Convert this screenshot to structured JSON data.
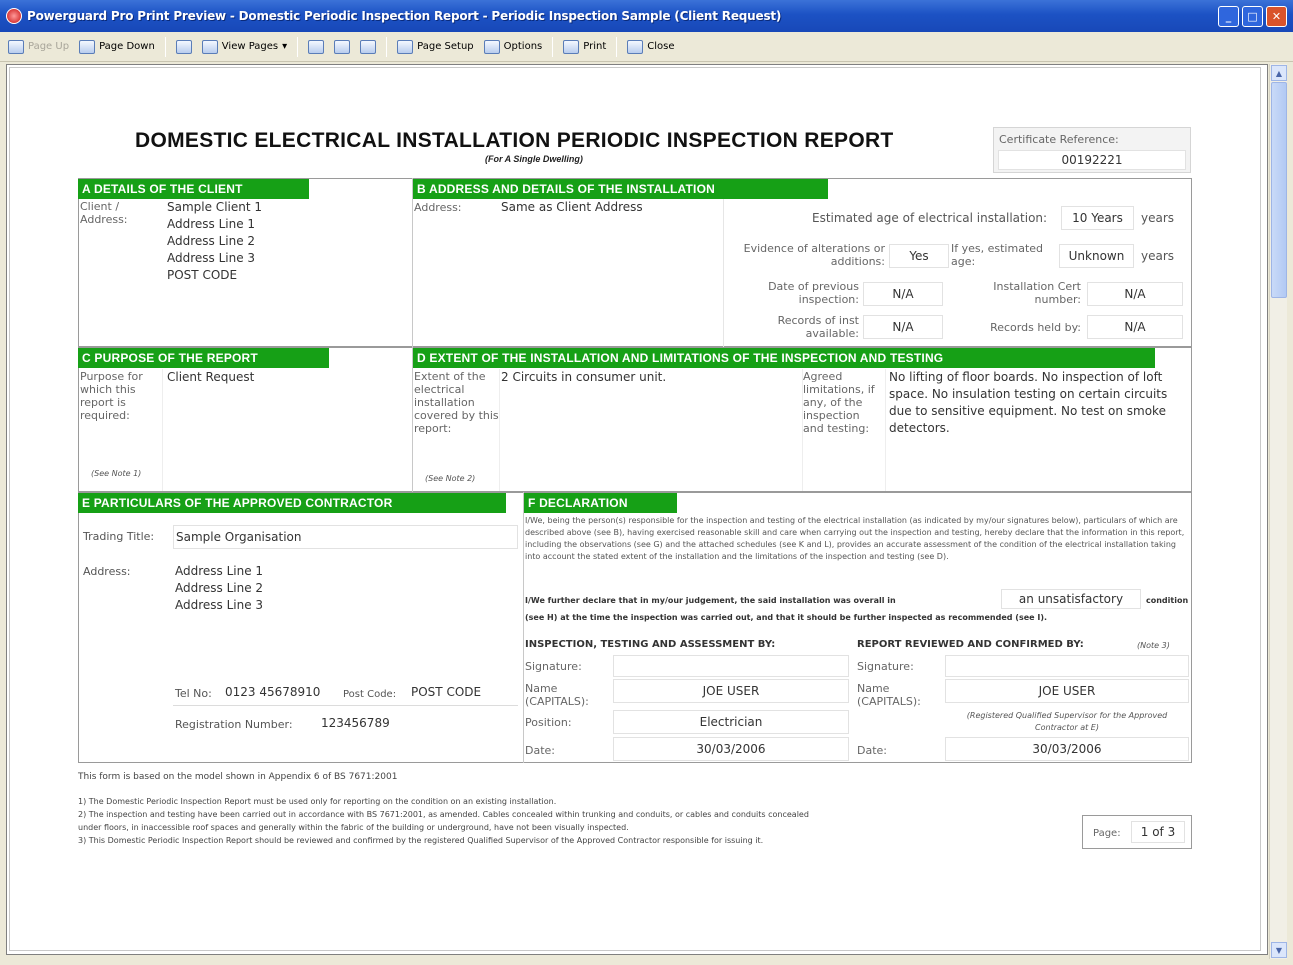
{
  "window": {
    "title": "Powerguard Pro Print Preview - Domestic Periodic Inspection Report - Periodic Inspection Sample (Client Request)"
  },
  "toolbar": {
    "page_up": "Page Up",
    "page_down": "Page Down",
    "view_pages": "View Pages",
    "page_setup": "Page Setup",
    "options": "Options",
    "print": "Print",
    "close": "Close"
  },
  "report": {
    "title": "DOMESTIC ELECTRICAL INSTALLATION PERIODIC INSPECTION REPORT",
    "subtitle": "(For A Single Dwelling)",
    "cert_ref_label": "Certificate Reference:",
    "cert_ref": "00192221",
    "sectionA": {
      "title": "A  DETAILS OF THE CLIENT",
      "client_label": "Client /",
      "address_label": "Address:",
      "lines": [
        "Sample Client 1",
        "Address Line 1",
        "Address Line 2",
        "Address Line 3",
        "POST CODE"
      ]
    },
    "sectionB": {
      "title": "B  ADDRESS AND DETAILS OF THE INSTALLATION",
      "address_label": "Address:",
      "address": "Same as Client Address",
      "est_age_label": "Estimated age of electrical installation:",
      "est_age": "10 Years",
      "years1": "years",
      "alterations_label": "Evidence of alterations or additions:",
      "alterations": "Yes",
      "alt_age_label": "If yes, estimated age:",
      "alt_age": "Unknown",
      "years2": "years",
      "prev_label": "Date of previous inspection:",
      "prev": "N/A",
      "cert_no_label": "Installation Cert number:",
      "cert_no": "N/A",
      "records_label": "Records of inst available:",
      "records": "N/A",
      "held_label": "Records held by:",
      "held": "N/A"
    },
    "sectionC": {
      "title": "C  PURPOSE OF THE REPORT",
      "label": "Purpose for which this report is required:",
      "value": "Client Request",
      "note": "(See Note 1)"
    },
    "sectionD": {
      "title": "D  EXTENT OF THE INSTALLATION AND LIMITATIONS OF THE INSPECTION AND TESTING",
      "extent_label": "Extent of the electrical installation covered by this report:",
      "extent": "2 Circuits in consumer unit.",
      "note": "(See Note 2)",
      "limits_label": "Agreed limitations, if any, of the inspection and testing:",
      "limits": "No lifting of floor boards. No inspection of loft space. No insulation testing on certain circuits due to sensitive equipment. No test on smoke detectors."
    },
    "sectionE": {
      "title": "E  PARTICULARS OF THE APPROVED CONTRACTOR",
      "trading_label": "Trading Title:",
      "trading": "Sample Organisation",
      "address_label": "Address:",
      "lines": [
        "Address Line 1",
        "Address Line 2",
        "Address Line 3"
      ],
      "tel_label": "Tel No:",
      "tel": "0123 45678910",
      "postcode_label": "Post Code:",
      "postcode": "POST CODE",
      "reg_label": "Registration Number:",
      "reg": "123456789"
    },
    "sectionF": {
      "title": "F  DECLARATION",
      "text1": "I/We, being the person(s) responsible for the inspection and testing of the electrical installation (as indicated by my/our signatures below), particulars of which are described above (see B), having exercised reasonable skill and care when carrying out the inspection and testing, hereby declare that the information in this report, including the observations (see G) and the attached schedules (see K and L), provides an accurate assessment of the condition of the electrical installation taking into account the stated extent of the installation and the limitations of the inspection and testing (see D).",
      "text2a": "I/We further declare that in my/our judgement, the said installation was overall in",
      "condition": "an unsatisfactory",
      "text2b": "condition",
      "text3": "(see H) at the time the inspection was carried out, and that it should be further inspected as recommended (see I).",
      "insp_title": "INSPECTION, TESTING AND ASSESSMENT BY:",
      "rev_title": "REPORT REVIEWED AND CONFIRMED BY:",
      "rev_note": "(Note 3)",
      "sig_label": "Signature:",
      "name_label": "Name (CAPITALS):",
      "pos_label": "Position:",
      "date_label": "Date:",
      "insp_name": "JOE USER",
      "insp_pos": "Electrician",
      "insp_date": "30/03/2006",
      "rev_name": "JOE USER",
      "rev_pos": "(Registered Qualified Supervisor for the Approved Contractor at E)",
      "rev_date": "30/03/2006"
    },
    "footer": {
      "model": "This form is based on the model shown in Appendix 6 of BS 7671:2001",
      "note1": "1) The Domestic Periodic Inspection Report must be used only for reporting on the condition on an existing installation.",
      "note2a": "2) The inspection and testing have been carried out in accordance with BS 7671:2001, as amended. Cables concealed within trunking and conduits, or cables and conduits concealed",
      "note2b": "under floors, in inaccessible roof spaces and generally within the fabric of the building or underground, have not been visually inspected.",
      "note3": "3) This Domestic Periodic Inspection Report should be reviewed and confirmed by the registered Qualified Supervisor of the Approved Contractor responsible for issuing it.",
      "page_label": "Page:",
      "page": "1 of 3"
    }
  },
  "colors": {
    "section_green": "#16a016",
    "titlebar_blue": "#1c52c4",
    "toolbar_bg": "#ece9d8"
  }
}
